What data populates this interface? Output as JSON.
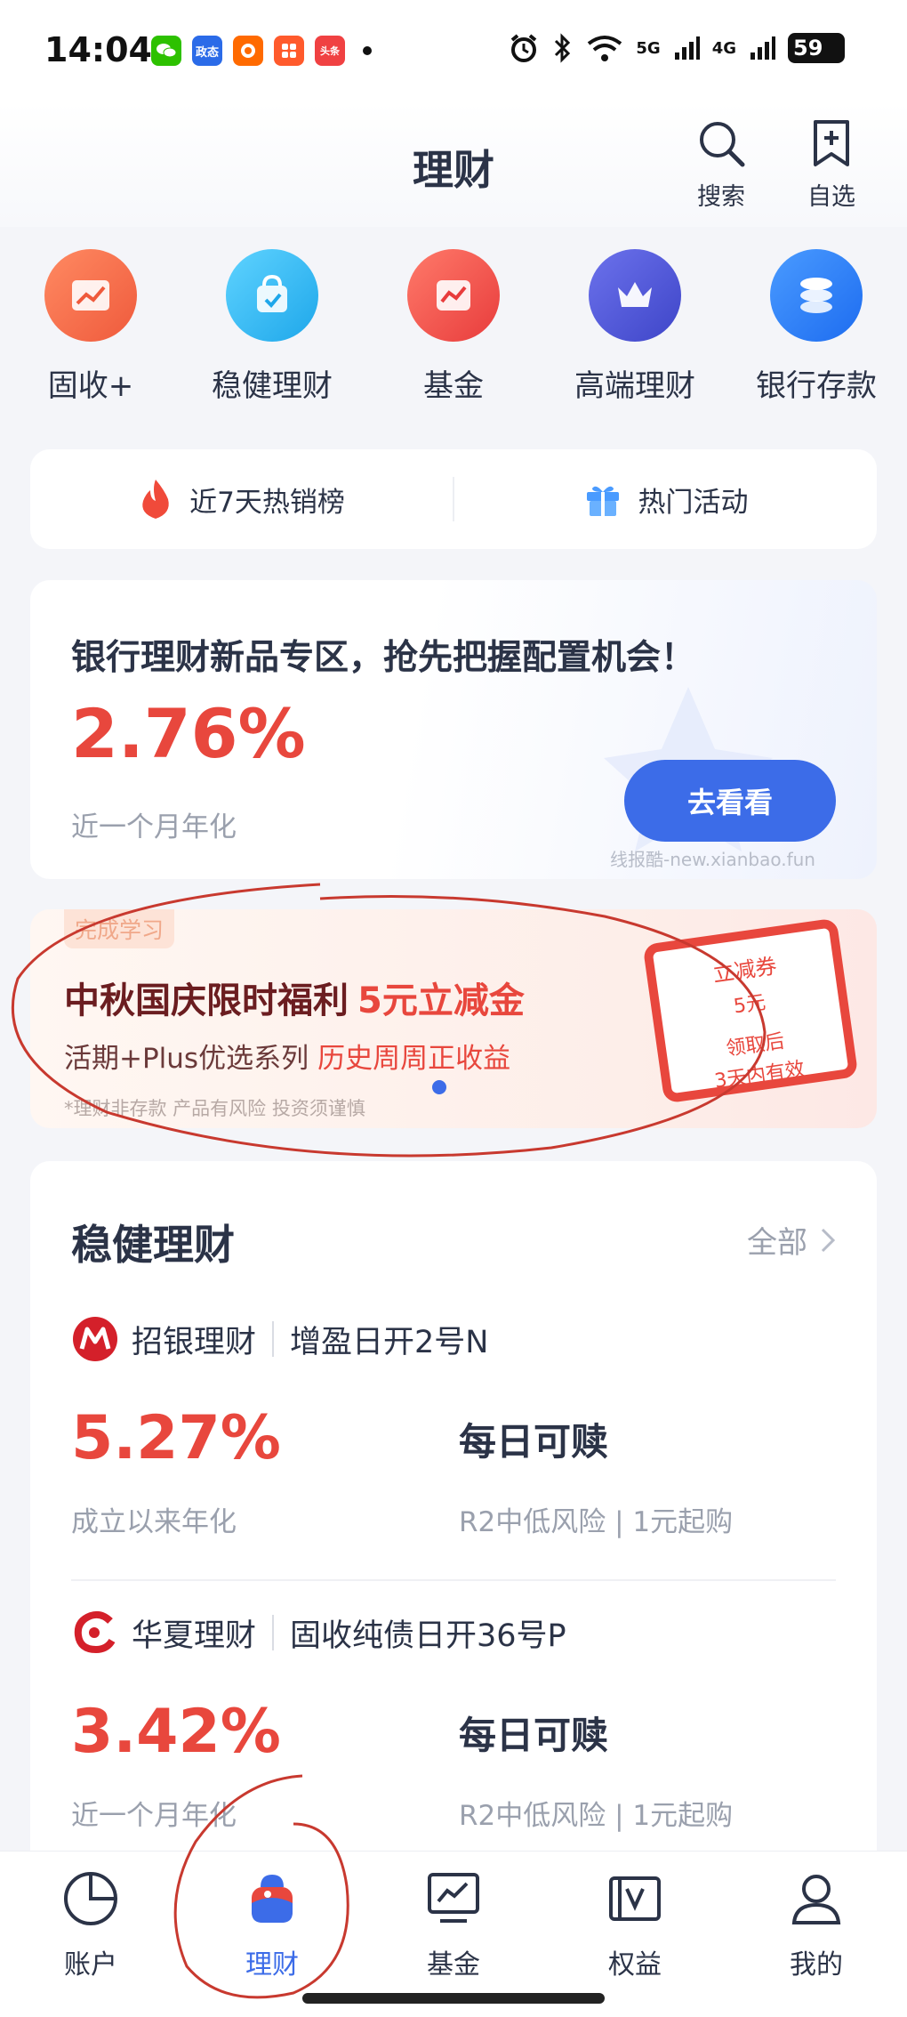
{
  "status_bar": {
    "time": "14:04",
    "notifications": [
      {
        "icon": "wechat-icon",
        "label": "",
        "color": "#2dc100"
      },
      {
        "icon": "app-icon-blue",
        "label": "政态",
        "color": "#2b6be8"
      },
      {
        "icon": "taobao-icon",
        "label": "",
        "color": "#ff6a00"
      },
      {
        "icon": "app-icon-orange",
        "label": "",
        "color": "#ff5a2c"
      },
      {
        "icon": "toutiao-icon",
        "label": "头条",
        "color": "#f04142"
      }
    ],
    "signal_1": "5G",
    "signal_2": "4G",
    "battery": "59"
  },
  "header": {
    "title": "理财",
    "search_label": "搜索",
    "watchlist_label": "自选"
  },
  "categories": [
    {
      "label": "固收+",
      "icon": "chart-up-icon",
      "color": "#f36a4c"
    },
    {
      "label": "稳健理财",
      "icon": "shield-bag-icon",
      "color": "#2cb7ef"
    },
    {
      "label": "基金",
      "icon": "fund-chart-icon",
      "color": "#ef4a44"
    },
    {
      "label": "高端理财",
      "icon": "crown-icon",
      "color": "#4b55d6"
    },
    {
      "label": "银行存款",
      "icon": "coins-icon",
      "color": "#2a7cf2"
    }
  ],
  "quick_links": {
    "hot_label": "近7天热销榜",
    "activity_label": "热门活动"
  },
  "banner": {
    "title": "银行理财新品专区，抢先把握配置机会！",
    "rate": "2.76%",
    "rate_label": "近一个月年化",
    "button": "去看看",
    "watermark": "线报酷-new.xianbao.fun"
  },
  "promo": {
    "tag": "完成学习",
    "title": "中秋国庆限时福利",
    "title_highlight": "5元立减金",
    "subtitle": "活期+Plus优选系列",
    "subtitle_highlight": "历史周周正收益",
    "disclaimer": "*理财非存款 产品有风险 投资须谨慎",
    "coupon_line1": "立减券",
    "coupon_line2": "5元",
    "coupon_line3": "领取后",
    "coupon_line4": "3天内有效"
  },
  "products_section": {
    "title": "稳健理财",
    "more": "全部",
    "items": [
      {
        "brand": "招银理财",
        "name": "增盈日开2号N",
        "rate": "5.27%",
        "rate_label": "成立以来年化",
        "redeem": "每日可赎",
        "risk": "R2中低风险 | 1元起购"
      },
      {
        "brand": "华夏理财",
        "name": "固收纯债日开36号P",
        "rate": "3.42%",
        "rate_label": "近一个月年化",
        "redeem": "每日可赎",
        "risk": "R2中低风险 | 1元起购"
      }
    ]
  },
  "bottom_nav": [
    {
      "label": "账户",
      "icon": "pie-chart-icon",
      "active": false
    },
    {
      "label": "理财",
      "icon": "wealth-bag-icon",
      "active": true
    },
    {
      "label": "基金",
      "icon": "fund-monitor-icon",
      "active": false
    },
    {
      "label": "权益",
      "icon": "benefits-icon",
      "active": false
    },
    {
      "label": "我的",
      "icon": "profile-icon",
      "active": false
    }
  ],
  "colors": {
    "accent": "#3c6ce8",
    "rate_red": "#e8473d",
    "text_dark": "#2b3347",
    "text_muted": "#9aa0ad"
  }
}
